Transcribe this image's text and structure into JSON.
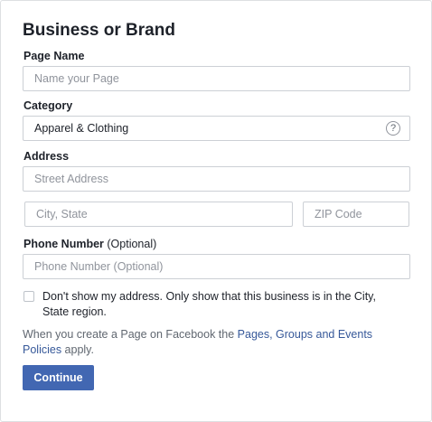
{
  "form": {
    "title": "Business or Brand",
    "page_name": {
      "label": "Page Name",
      "placeholder": "Name your Page"
    },
    "category": {
      "label": "Category",
      "value": "Apparel & Clothing",
      "help_icon": "question-mark-circle",
      "help_glyph": "?"
    },
    "address": {
      "label": "Address",
      "street_placeholder": "Street Address",
      "city_placeholder": "City, State",
      "zip_placeholder": "ZIP Code"
    },
    "phone": {
      "label": "Phone Number",
      "optional": "(Optional)",
      "placeholder": "Phone Number (Optional)"
    },
    "hide_address": {
      "checked": false,
      "label": "Don't show my address. Only show that this business is in the City, State region."
    },
    "policy": {
      "prefix": "When you create a Page on Facebook the ",
      "link_text": "Pages, Groups and Events Policies",
      "suffix": " apply."
    },
    "continue_label": "Continue"
  },
  "colors": {
    "primary_button": "#4267b2",
    "link": "#365899",
    "text": "#1d2129",
    "muted_text": "#606770",
    "border": "#ccd0d5"
  }
}
